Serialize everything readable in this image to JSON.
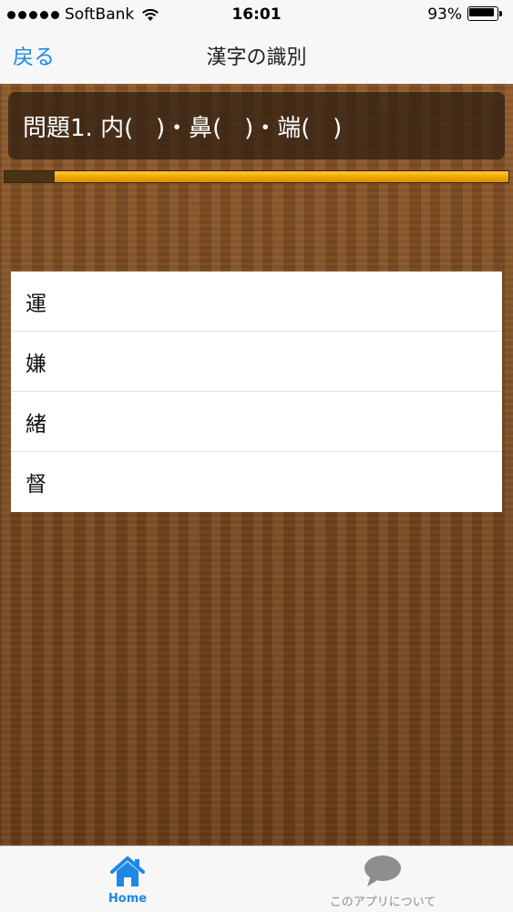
{
  "status_bar": {
    "carrier": "SoftBank",
    "time": "16:01",
    "battery": "93%",
    "icons": [
      "signal-dots-icon",
      "wifi-icon",
      "battery-icon"
    ]
  },
  "nav": {
    "back_label": "戻る",
    "title": "漢字の識別"
  },
  "question": {
    "text": "問題1. 内(   )・鼻(   )・端(   )"
  },
  "progress": {
    "fraction": 0.1
  },
  "answers": [
    {
      "label": "運"
    },
    {
      "label": "嫌"
    },
    {
      "label": "緒"
    },
    {
      "label": "督"
    }
  ],
  "tabs": [
    {
      "label": "Home",
      "icon": "home-icon",
      "selected": true
    },
    {
      "label": "このアプリについて",
      "icon": "speech-bubble-icon",
      "selected": false
    }
  ],
  "colors": {
    "accent": "#1e88e5",
    "progress": "#f2a900",
    "wood": "#7b4a20"
  }
}
